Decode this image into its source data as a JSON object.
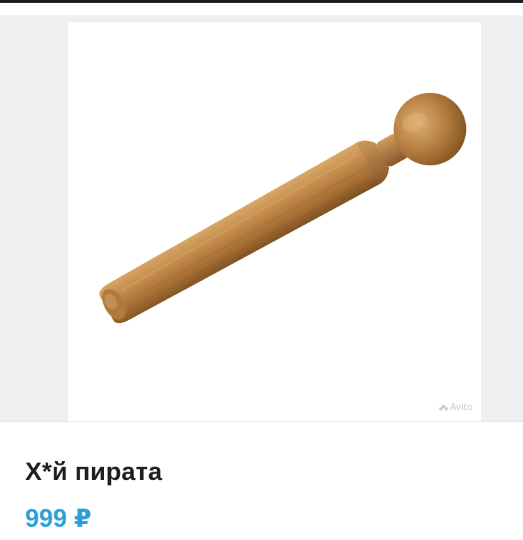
{
  "listing": {
    "title": "Х*й пирата",
    "price": "999 ₽",
    "image": {
      "subject": "wooden-peg-icon",
      "watermark": "Avito"
    }
  },
  "colors": {
    "price": "#2e9fd6",
    "title": "#1e1e1e",
    "gallery_bg": "#efefef",
    "wood_main": "#b07a3e",
    "wood_dark": "#7a4f22"
  }
}
